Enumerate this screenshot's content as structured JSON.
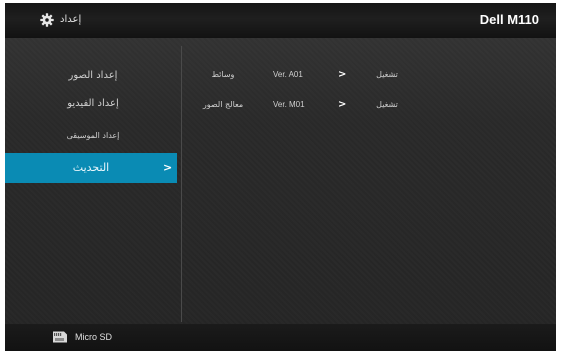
{
  "header": {
    "title": "إعداد",
    "brand": "Dell M110",
    "icon": "gear-icon"
  },
  "sidebar": {
    "items": [
      {
        "label": "إعداد الصور"
      },
      {
        "label": "إعداد الفيديو"
      },
      {
        "label": "إعداد الموسيقى"
      },
      {
        "label": "التحديث",
        "selected": true,
        "arrow": ">"
      }
    ],
    "accent_color": "#0a8bb4"
  },
  "detail": {
    "rows": [
      {
        "name": "وسائط",
        "version": "Ver. A01",
        "arrow": ">",
        "action": "تشغيل"
      },
      {
        "name": "معالج الصور",
        "version": "Ver. M01",
        "arrow": ">",
        "action": "تشغيل"
      }
    ]
  },
  "footer": {
    "storage_label": "Micro SD",
    "storage_icon": "micro-sd-icon"
  }
}
